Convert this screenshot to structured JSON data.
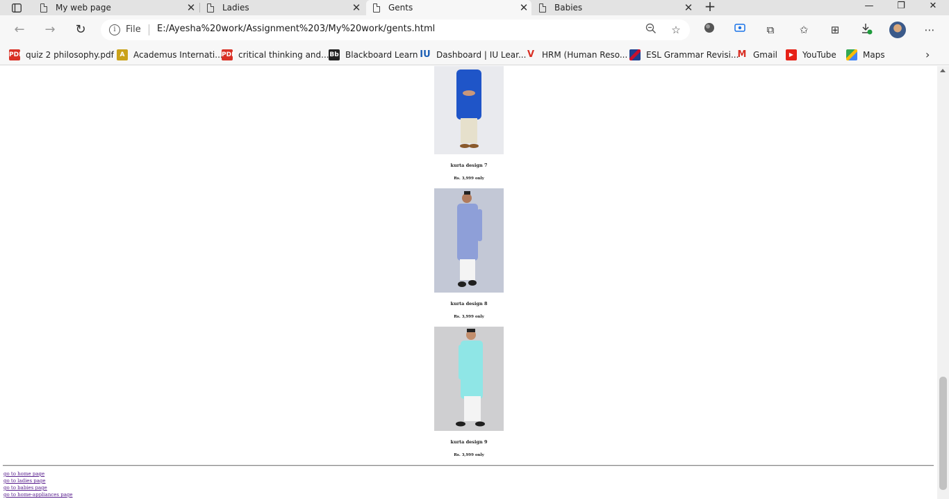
{
  "browser": {
    "tabs": [
      {
        "label": "My web page",
        "active": false
      },
      {
        "label": "Ladies",
        "active": false
      },
      {
        "label": "Gents",
        "active": true
      },
      {
        "label": "Babies",
        "active": false
      }
    ],
    "address": {
      "scheme_label": "File",
      "url": "E:/Ayesha%20work/Assignment%203/My%20work/gents.html"
    },
    "favorites": [
      {
        "label": "quiz 2 philosophy.pdf",
        "icon": "pdf-icon"
      },
      {
        "label": "Academus Internati...",
        "icon": "academus-icon"
      },
      {
        "label": "critical thinking and...",
        "icon": "pdf-icon"
      },
      {
        "label": "Blackboard Learn",
        "icon": "blackboard-icon"
      },
      {
        "label": "Dashboard | IU Lear...",
        "icon": "iu-icon"
      },
      {
        "label": "HRM (Human Reso...",
        "icon": "hrm-icon"
      },
      {
        "label": "ESL Grammar Revisi...",
        "icon": "uk-flag-icon"
      },
      {
        "label": "Gmail",
        "icon": "gmail-icon"
      },
      {
        "label": "YouTube",
        "icon": "youtube-icon"
      },
      {
        "label": "Maps",
        "icon": "maps-icon"
      }
    ]
  },
  "page": {
    "products": [
      {
        "name": "kurta design 7",
        "price": "Rs. 3,999 only",
        "kurta_color": "#1f55c8",
        "pants_color": "#e6e0cc"
      },
      {
        "name": "kurta design 8",
        "price": "Rs. 3,999 only",
        "kurta_color": "#8e9fd8",
        "pants_color": "#f4f4f4"
      },
      {
        "name": "kurta design 9",
        "price": "Rs. 3,999 only",
        "kurta_color": "#8fe6e6",
        "pants_color": "#f4f4f4"
      }
    ],
    "links": [
      "go to home page",
      "go to ladies page",
      "go to babies page",
      "go to home-appliances page"
    ]
  }
}
